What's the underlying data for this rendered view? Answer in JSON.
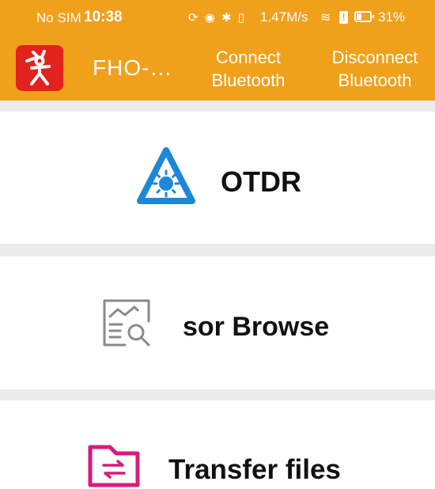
{
  "status_bar": {
    "carrier": "No SIM",
    "time": "10:38",
    "icons": "⟳ ◉ ✱ ▯",
    "network_speed": "1.47M/s",
    "wifi": "≋",
    "alert": "!",
    "battery": "31%"
  },
  "app_bar": {
    "title": "FHO-…",
    "connect_label": {
      "line1": "Connect",
      "line2": "Bluetooth"
    },
    "disconnect_label": {
      "line1": "Disconnect",
      "line2": "Bluetooth"
    }
  },
  "menu": {
    "items": [
      {
        "label": "OTDR",
        "icon": "otdr-warning-icon"
      },
      {
        "label": "sor Browse",
        "icon": "chart-search-icon"
      },
      {
        "label": "Transfer files",
        "icon": "folder-transfer-icon"
      }
    ]
  },
  "colors": {
    "app_bar": "#F0A01A",
    "logo": "#E2221C",
    "otdr_icon": "#1E88D8",
    "browse_icon": "#8A8A8A",
    "transfer_icon": "#D81B7A",
    "divider": "#EBEBEB"
  }
}
